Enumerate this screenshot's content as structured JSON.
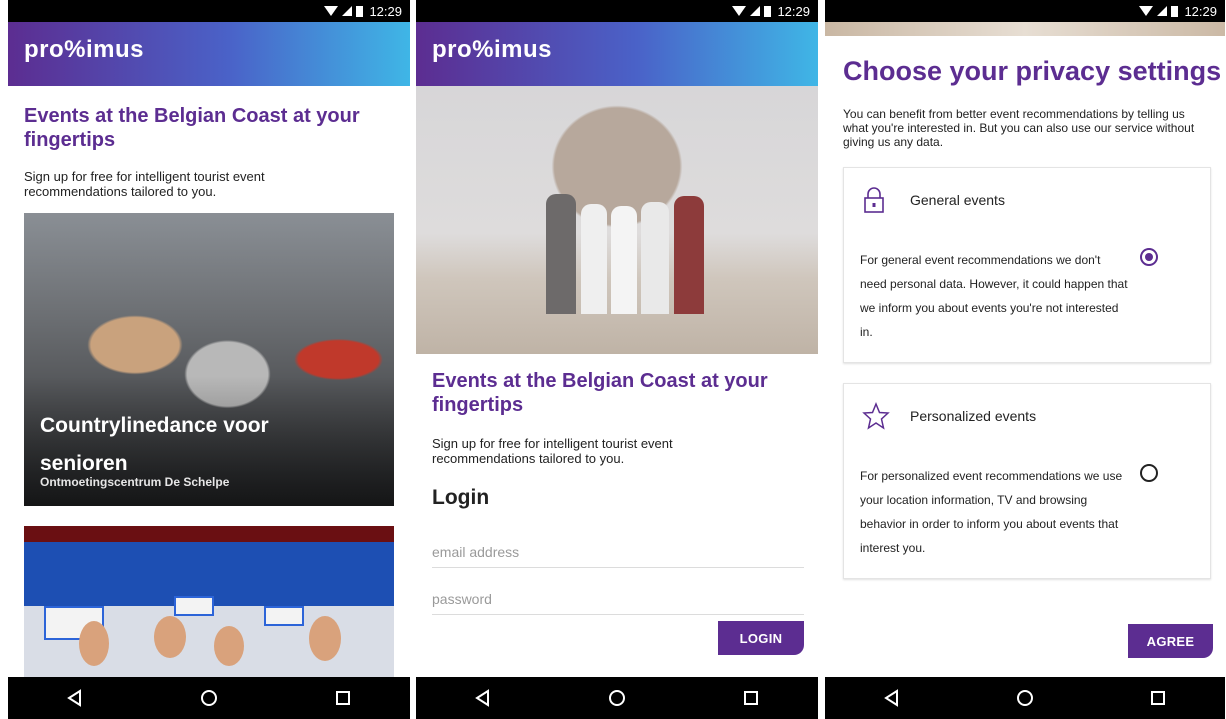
{
  "status": {
    "time": "12:29"
  },
  "brand": {
    "logo": "pro%imus",
    "primary_color": "#5c2d91",
    "gradient_end": "#3fb6e6"
  },
  "screen1": {
    "title": "Events at the Belgian Coast at your fingertips",
    "subtitle": "Sign up for free for intelligent tourist event recommendations tailored to you.",
    "event_card": {
      "title": "Countrylinedance voor senioren",
      "venue": "Ontmoetingscentrum De Schelpe"
    }
  },
  "screen2": {
    "title": "Events at the Belgian Coast at your fingertips",
    "subtitle": "Sign up for free for intelligent tourist event recommendations tailored to you.",
    "login_heading": "Login",
    "email_placeholder": "email address",
    "password_placeholder": "password",
    "login_button": "LOGIN"
  },
  "screen3": {
    "title": "Choose your privacy settings",
    "intro": "You can benefit from better event recommendations by telling us what you're interested in. But you can also use our service without giving us any data.",
    "options": [
      {
        "name": "General events",
        "icon": "lock-icon",
        "selected": true,
        "description": "For general event recommendations we don't need personal data. However, it could happen that we inform you about events you're not interested in."
      },
      {
        "name": "Personalized events",
        "icon": "star-icon",
        "selected": false,
        "description": "For personalized event recommendations we use your location information, TV and browsing behavior in order to inform you about events that interest you."
      }
    ],
    "agree_button": "AGREE"
  }
}
